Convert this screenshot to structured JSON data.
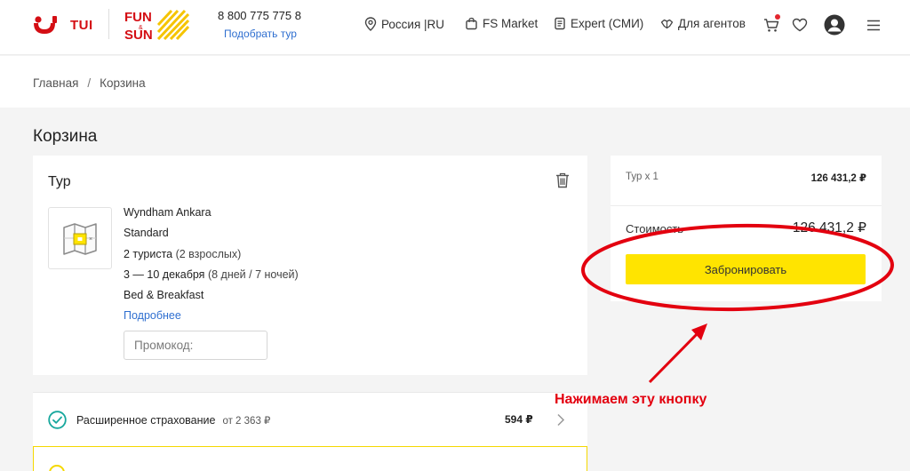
{
  "header": {
    "brand": "TUI",
    "brand2_line1": "FUN",
    "brand2_amp": "&",
    "brand2_line2": "SUN",
    "phone": "8 800 775 775 8",
    "pick_tour": "Подобрать тур",
    "nav": {
      "region": "Россия  |RU",
      "market": "FS Market",
      "expert": "Expert (СМИ)",
      "agents": "Для агентов"
    },
    "icons": [
      "cart-icon",
      "heart-icon",
      "user-icon",
      "menu-icon"
    ],
    "colors": {
      "brand_red": "#d40e14",
      "link": "#2f6fd0",
      "accent_yellow": "#ffe400"
    }
  },
  "breadcrumb": {
    "home": "Главная",
    "separator": "/",
    "current": "Корзина"
  },
  "page_title": "Корзина",
  "tour": {
    "title": "Тур",
    "hotel": "Wyndham Ankara",
    "room": "Standard",
    "tourists_bold": "2 туриста",
    "tourists_detail": " (2 взрослых)",
    "dates_bold": "3 — 10 декабря",
    "dates_detail": " (8 дней / 7 ночей)",
    "meal": "Bed & Breakfast",
    "more_link": "Подробнее",
    "promo_placeholder": "Промокод:"
  },
  "insurance": {
    "label": "Расширенное страхование",
    "from": "от 2 363 ₽",
    "price": "594 ₽"
  },
  "summary": {
    "tour_label": "Тур х 1",
    "tour_value": "126 431,2 ₽",
    "cost_label": "Стоимость",
    "cost_value": "126 431,2 ₽",
    "book_button": "Забронировать"
  },
  "annotation": {
    "text": "Нажимаем эту кнопку",
    "color": "#e3000f"
  }
}
